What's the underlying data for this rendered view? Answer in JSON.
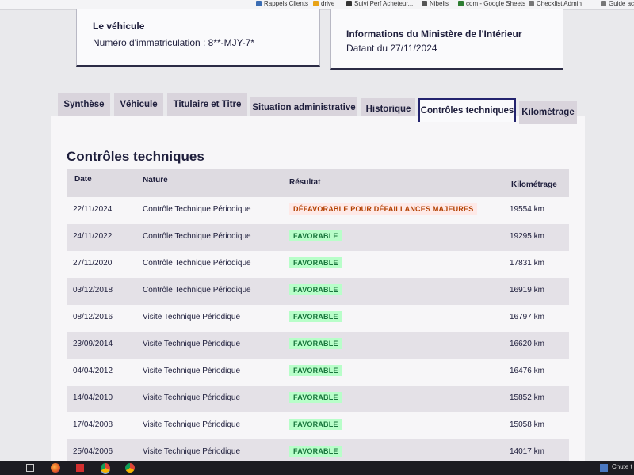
{
  "bookmarks": [
    {
      "label": "Rappels Clients",
      "color": "#3b6db3"
    },
    {
      "label": "drive",
      "color": "#e8a317"
    },
    {
      "label": "Suivi Perf Acheteur...",
      "color": "#333333"
    },
    {
      "label": "Nibelis",
      "color": "#555555"
    },
    {
      "label": "com - Google Sheets",
      "color": "#2e7d32"
    },
    {
      "label": "Checklist Admin",
      "color": "#777777"
    },
    {
      "label": "Guide ach",
      "color": "#777777"
    }
  ],
  "vehicle_card": {
    "title": "Le véhicule",
    "registration": "Numéro d'immatriculation : 8**-MJY-7*"
  },
  "ministry_card": {
    "title": "Informations du Ministère de l'Intérieur",
    "date": "Datant du 27/11/2024"
  },
  "tabs": [
    {
      "label": "Synthèse",
      "active": false
    },
    {
      "label": "Véhicule",
      "active": false
    },
    {
      "label": "Titulaire et Titre",
      "active": false
    },
    {
      "label": "Situation administrative",
      "active": false
    },
    {
      "label": "Historique",
      "active": false
    },
    {
      "label": "Contrôles techniques",
      "active": true
    },
    {
      "label": "Kilométrage",
      "active": false
    }
  ],
  "section": {
    "title": "Contrôles techniques",
    "columns": [
      "Date",
      "Nature",
      "Résultat",
      "Kilométrage"
    ],
    "rows": [
      {
        "date": "22/11/2024",
        "nature": "Contrôle Technique Périodique",
        "result": "DÉFAVORABLE POUR DÉFAILLANCES MAJEURES",
        "status": "unfavorable",
        "km": "19554 km"
      },
      {
        "date": "24/11/2022",
        "nature": "Contrôle Technique Périodique",
        "result": "FAVORABLE",
        "status": "favorable",
        "km": "19295 km"
      },
      {
        "date": "27/11/2020",
        "nature": "Contrôle Technique Périodique",
        "result": "FAVORABLE",
        "status": "favorable",
        "km": "17831 km"
      },
      {
        "date": "03/12/2018",
        "nature": "Contrôle Technique Périodique",
        "result": "FAVORABLE",
        "status": "favorable",
        "km": "16919 km"
      },
      {
        "date": "08/12/2016",
        "nature": "Visite Technique Périodique",
        "result": "FAVORABLE",
        "status": "favorable",
        "km": "16797 km"
      },
      {
        "date": "23/09/2014",
        "nature": "Visite Technique Périodique",
        "result": "FAVORABLE",
        "status": "favorable",
        "km": "16620 km"
      },
      {
        "date": "04/04/2012",
        "nature": "Visite Technique Périodique",
        "result": "FAVORABLE",
        "status": "favorable",
        "km": "16476 km"
      },
      {
        "date": "14/04/2010",
        "nature": "Visite Technique Périodique",
        "result": "FAVORABLE",
        "status": "favorable",
        "km": "15852 km"
      },
      {
        "date": "17/04/2008",
        "nature": "Visite Technique Périodique",
        "result": "FAVORABLE",
        "status": "favorable",
        "km": "15058 km"
      },
      {
        "date": "25/04/2006",
        "nature": "Visite Technique Périodique",
        "result": "FAVORABLE",
        "status": "favorable",
        "km": "14017 km"
      }
    ]
  },
  "taskbar": {
    "notification": "Chute t",
    "icons": [
      "task-view-icon",
      "firefox-icon",
      "acrobat-icon",
      "chrome-icon",
      "chrome-icon-2"
    ]
  },
  "colors": {
    "favorable_bg": "#b8fec9",
    "favorable_text": "#18753c",
    "unfavorable_bg": "#fee9e7",
    "unfavorable_text": "#b34000",
    "active_tab_border": "#23236e"
  }
}
